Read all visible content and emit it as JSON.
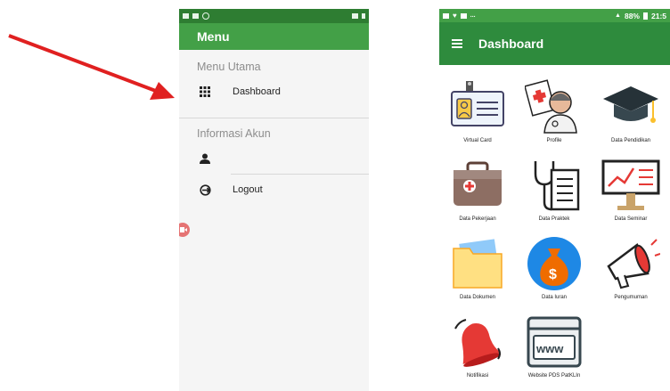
{
  "menu_screen": {
    "title": "Menu",
    "section_main": "Menu Utama",
    "item_dashboard": "Dashboard",
    "section_account": "Informasi Akun",
    "item_profile": "",
    "item_logout": "Logout"
  },
  "dashboard_screen": {
    "status": {
      "battery": "88%",
      "time": "21:5"
    },
    "title": "Dashboard",
    "tiles": [
      {
        "label": "Virtual Card",
        "icon": "virtual-card-icon"
      },
      {
        "label": "Profile",
        "icon": "doctor-profile-icon"
      },
      {
        "label": "Data Pendidikan",
        "icon": "graduation-cap-icon"
      },
      {
        "label": "Data Pekerjaan",
        "icon": "medical-bag-icon"
      },
      {
        "label": "Data Praktek",
        "icon": "stethoscope-document-icon"
      },
      {
        "label": "Data Seminar",
        "icon": "presentation-board-icon"
      },
      {
        "label": "Data Dokumen",
        "icon": "folder-icon"
      },
      {
        "label": "Data Iuran",
        "icon": "money-bag-icon"
      },
      {
        "label": "Pengumuman",
        "icon": "megaphone-icon"
      },
      {
        "label": "Notifikasi",
        "icon": "bell-icon"
      },
      {
        "label": "Website PDS PatKLIn",
        "icon": "www-browser-icon"
      }
    ]
  },
  "colors": {
    "green_dark": "#2e7d32",
    "green": "#43a047",
    "arrow": "#e02020"
  }
}
